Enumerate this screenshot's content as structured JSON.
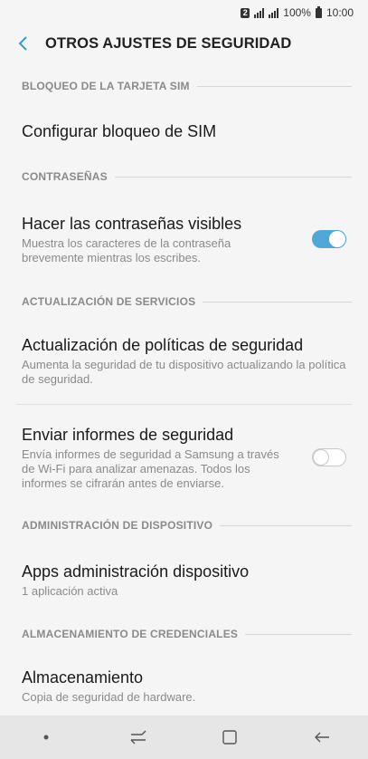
{
  "status_bar": {
    "sim_slot": "2",
    "battery": "100%",
    "time": "10:00"
  },
  "header": {
    "title": "OTROS AJUSTES DE SEGURIDAD",
    "back_icon": "chevron-left-icon",
    "accent_color": "#3a9bd1"
  },
  "sections": [
    {
      "header": "BLOQUEO DE LA TARJETA SIM",
      "items": [
        {
          "title": "Configurar bloqueo de SIM"
        }
      ]
    },
    {
      "header": "CONTRASEÑAS",
      "items": [
        {
          "title": "Hacer las contraseñas visibles",
          "desc": "Muestra los caracteres de la contraseña brevemente mientras los escribes.",
          "toggle": true
        }
      ]
    },
    {
      "header": "ACTUALIZACIÓN DE SERVICIOS",
      "items": [
        {
          "title": "Actualización de políticas de seguridad",
          "desc": "Aumenta la seguridad de tu dispositivo actualizando la política de seguridad."
        },
        {
          "title": "Enviar informes de seguridad",
          "desc": "Envía informes de seguridad a Samsung a través de Wi-Fi para analizar amenazas. Todos los informes se cifrarán antes de enviarse.",
          "toggle": false
        }
      ]
    },
    {
      "header": "ADMINISTRACIÓN DE DISPOSITIVO",
      "items": [
        {
          "title": "Apps administración dispositivo",
          "desc": "1 aplicación activa"
        }
      ]
    },
    {
      "header": "ALMACENAMIENTO DE CREDENCIALES",
      "items": [
        {
          "title": "Almacenamiento",
          "desc": "Copia de seguridad de hardware."
        }
      ]
    }
  ],
  "toggle_colors": {
    "on": "#4fa8d8",
    "off": "#c8c8c8"
  },
  "nav_bar": [
    "dot-icon",
    "recent-apps-icon",
    "home-icon",
    "back-arrow-icon"
  ]
}
